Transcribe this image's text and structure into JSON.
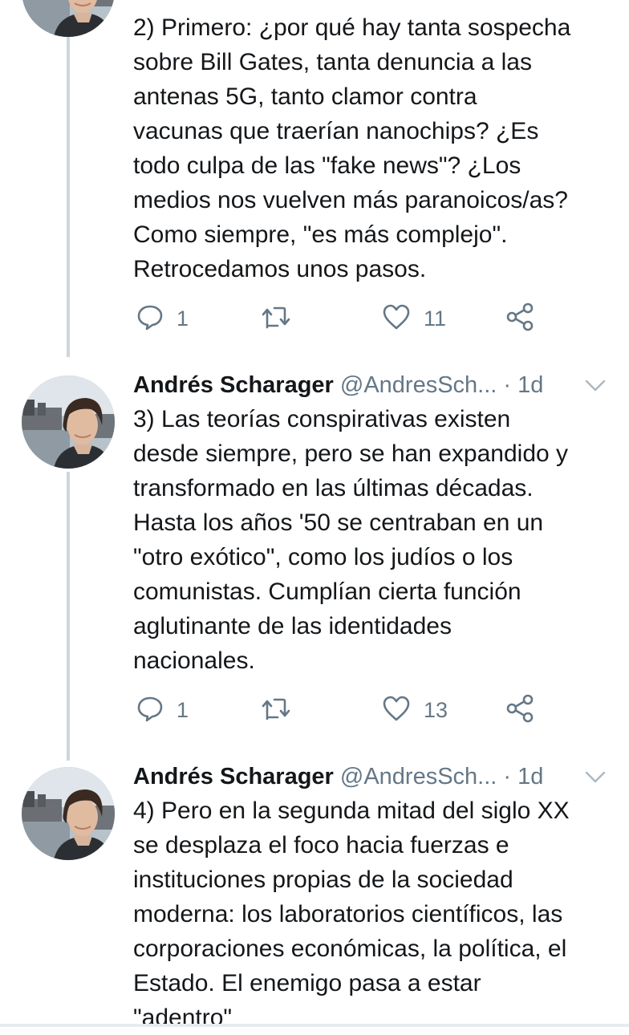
{
  "tweets": [
    {
      "author": "",
      "handle": "",
      "time": "",
      "lines": [
        "2) Primero: ¿por qué hay tanta sospecha",
        "sobre Bill Gates, tanta denuncia a las",
        "antenas 5G, tanto clamor contra",
        "vacunas que traerían nanochips? ¿Es",
        "todo culpa de las \"fake news\"? ¿Los",
        "medios nos vuelven más paranoicos/as?",
        "Como siempre, \"es más complejo\".",
        "Retrocedamos unos pasos."
      ],
      "replies": "1",
      "retweets": "",
      "likes": "11"
    },
    {
      "author": "Andrés Scharager",
      "handle": "@AndresSch...",
      "separator": "·",
      "time": "1d",
      "lines": [
        "3) Las teorías conspirativas existen",
        "desde siempre, pero se han expandido y",
        "transformado en las últimas décadas.",
        "Hasta los años '50 se centraban en un",
        "\"otro exótico\", como los judíos o los",
        "comunistas. Cumplían cierta función",
        "aglutinante de las identidades",
        "nacionales."
      ],
      "replies": "1",
      "retweets": "",
      "likes": "13"
    },
    {
      "author": "Andrés Scharager",
      "handle": "@AndresSch...",
      "separator": "·",
      "time": "1d",
      "lines": [
        "4) Pero en la segunda mitad del siglo XX",
        "se desplaza el foco hacia fuerzas e",
        "instituciones propias de la sociedad",
        "moderna: los laboratorios científicos, las",
        "corporaciones económicas, la política, el",
        "Estado. El enemigo pasa a estar",
        "\"adentro\""
      ]
    }
  ],
  "icons": {
    "reply": "reply-icon",
    "retweet": "retweet-icon",
    "like": "like-icon",
    "share": "share-icon",
    "caret": "chevron-down-icon"
  },
  "colors": {
    "text": "#14171a",
    "secondary": "#657786",
    "thread_line": "#ccd6dd"
  }
}
